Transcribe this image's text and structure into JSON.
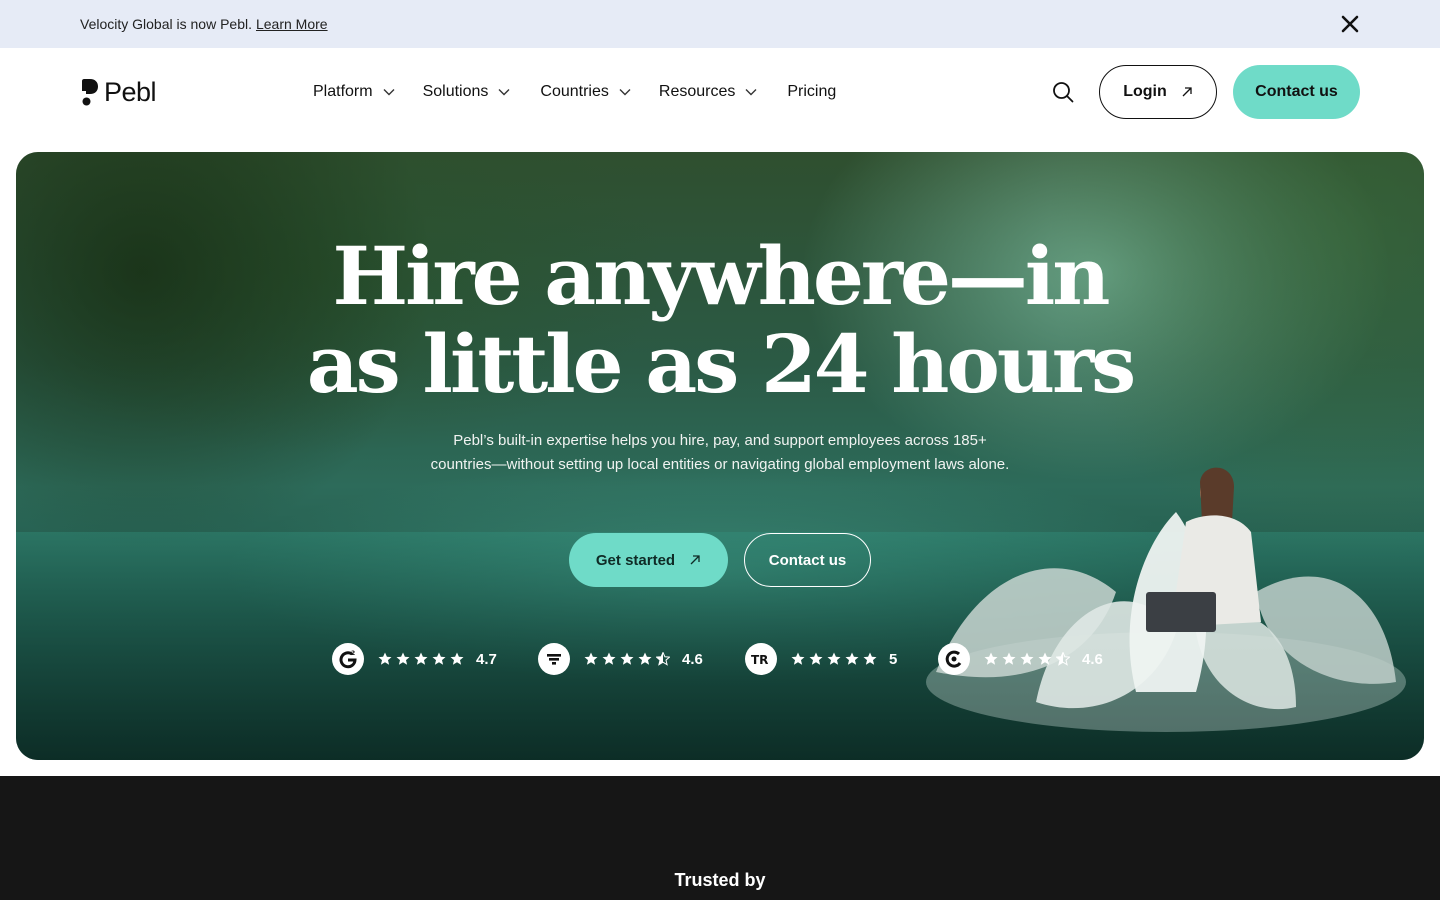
{
  "announcement": {
    "message": "Velocity Global is now Pebl.",
    "link_label": "Learn More"
  },
  "brand": {
    "name": "Pebl",
    "accent_color": "#6fdbc8"
  },
  "nav": {
    "items": [
      {
        "label": "Platform",
        "has_dropdown": true
      },
      {
        "label": "Solutions",
        "has_dropdown": true
      },
      {
        "label": "Countries",
        "has_dropdown": true
      },
      {
        "label": "Resources",
        "has_dropdown": true
      },
      {
        "label": "Pricing",
        "has_dropdown": false
      }
    ],
    "login_label": "Login",
    "contact_label": "Contact us"
  },
  "hero": {
    "title_line1": "Hire anywhere—in",
    "title_line2": "as little as 24 hours",
    "subtitle": "Pebl’s built-in expertise helps you hire, pay, and support employees across 185+ countries—without setting up local entities or navigating global employment laws alone.",
    "primary_cta": "Get started",
    "secondary_cta": "Contact us",
    "ratings": [
      {
        "source_icon": "g2-icon",
        "stars": 5,
        "score": "4.7"
      },
      {
        "source_icon": "capterra-icon",
        "stars": 4.5,
        "score": "4.6"
      },
      {
        "source_icon": "trustradius-icon",
        "stars": 5,
        "score": "5"
      },
      {
        "source_icon": "getapp-icon",
        "stars": 4.5,
        "score": "4.6"
      }
    ]
  },
  "trusted": {
    "label": "Trusted by"
  }
}
